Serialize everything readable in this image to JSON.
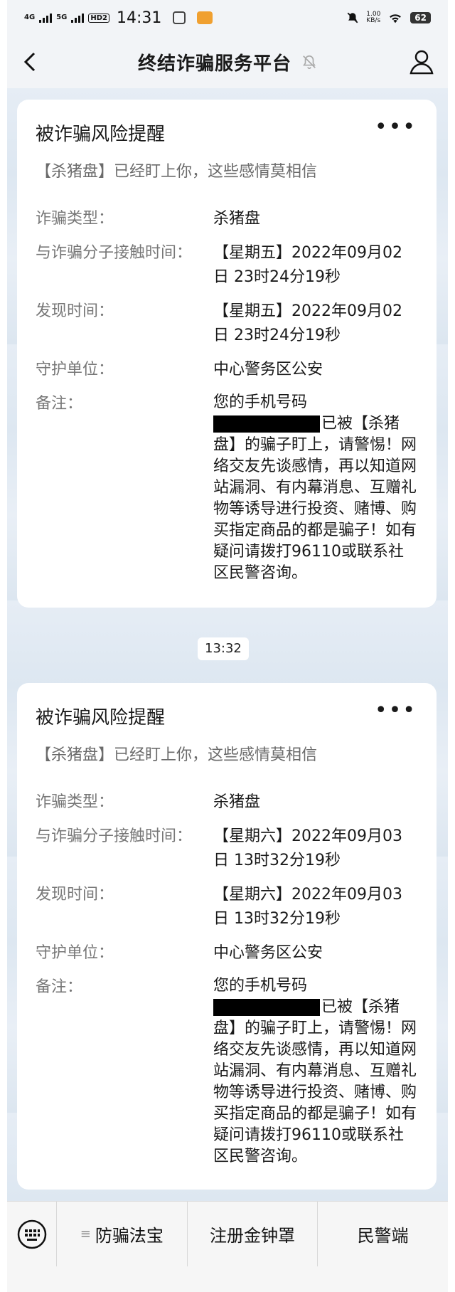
{
  "status_bar": {
    "network_1": "4G",
    "network_2": "5G",
    "hd_badge": "HD2",
    "time": "14:31",
    "speed_value": "1.00",
    "speed_unit": "KB/s",
    "battery": "62"
  },
  "navbar": {
    "title": "终结诈骗服务平台",
    "back_icon": "chevron-left-icon",
    "mute_icon": "bell-off-icon",
    "profile_icon": "user-icon"
  },
  "messages": [
    {
      "title": "被诈骗风险提醒",
      "more": "•••",
      "subtitle": "【杀猪盘】已经盯上你，这些感情莫相信",
      "fields": {
        "type_label": "诈骗类型：",
        "type_value": "杀猪盘",
        "contact_label": "与诈骗分子接触时间：",
        "contact_value": "【星期五】2022年09月02日 23时24分19秒",
        "found_label": "发现时间：",
        "found_value": "【星期五】2022年09月02日 23时24分19秒",
        "unit_label": "守护单位：",
        "unit_value": "中心警务区公安",
        "note_label": "备注：",
        "note_prefix": "您的手机号码",
        "note_body": "已被【杀猪盘】的骗子盯上，请警惕！网络交友先谈感情，再以知道网站漏洞、有内幕消息、互赠礼物等诱导进行投资、赌博、购买指定商品的都是骗子！如有疑问请拨打96110或联系社区民警咨询。"
      }
    },
    {
      "title": "被诈骗风险提醒",
      "more": "•••",
      "subtitle": "【杀猪盘】已经盯上你，这些感情莫相信",
      "fields": {
        "type_label": "诈骗类型：",
        "type_value": "杀猪盘",
        "contact_label": "与诈骗分子接触时间：",
        "contact_value": "【星期六】2022年09月03日 13时32分19秒",
        "found_label": "发现时间：",
        "found_value": "【星期六】2022年09月03日 13时32分19秒",
        "unit_label": "守护单位：",
        "unit_value": "中心警务区公安",
        "note_label": "备注：",
        "note_prefix": "您的手机号码",
        "note_body": "已被【杀猪盘】的骗子盯上，请警惕！网络交友先谈感情，再以知道网站漏洞、有内幕消息、互赠礼物等诱导进行投资、赌博、购买指定商品的都是骗子！如有疑问请拨打96110或联系社区民警咨询。"
      }
    }
  ],
  "timestamp": "13:32",
  "bottom_menu": {
    "keyboard_icon": "keyboard-icon",
    "items": [
      {
        "label": "防骗法宝",
        "glyph": "≡"
      },
      {
        "label": "注册金钟罩"
      },
      {
        "label": "民警端"
      }
    ]
  },
  "colors": {
    "background": "#f2f4f7",
    "card": "#ffffff",
    "label_text": "#777777",
    "subtitle_text": "#6b6b6b"
  }
}
